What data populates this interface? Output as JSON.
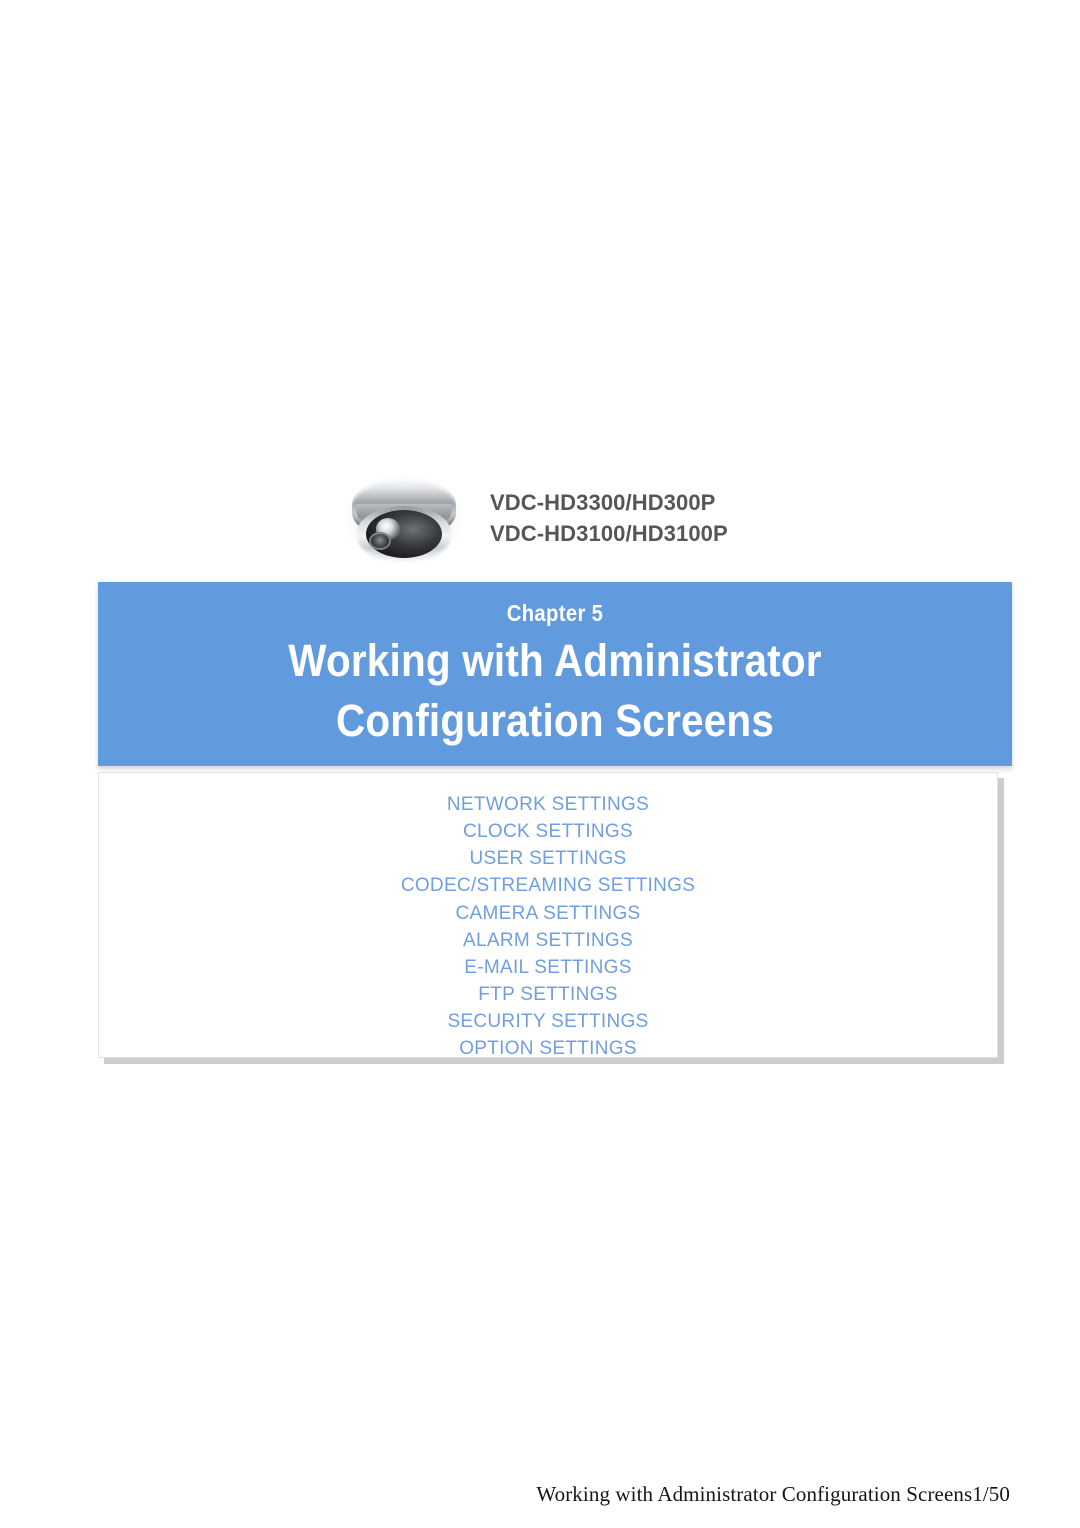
{
  "product": {
    "camera_icon": "dome-camera-icon",
    "model_lines": [
      "VDC-HD3300/HD300P",
      "VDC-HD3100/HD3100P"
    ]
  },
  "banner": {
    "chapter_label": "Chapter 5",
    "title_line_1": "Working with Administrator",
    "title_line_2": "Configuration Screens",
    "background_color": "#629ade",
    "text_color": "#ffffff"
  },
  "settings_list": {
    "text_color": "#6f9fe0",
    "items": [
      "NETWORK SETTINGS",
      "CLOCK SETTINGS",
      "USER SETTINGS",
      "CODEC/STREAMING SETTINGS",
      "CAMERA SETTINGS",
      "ALARM SETTINGS",
      "E-MAIL SETTINGS",
      "FTP SETTINGS",
      "SECURITY SETTINGS",
      "OPTION SETTINGS"
    ]
  },
  "footer": {
    "text": "Working with Administrator Configuration Screens1/50"
  }
}
